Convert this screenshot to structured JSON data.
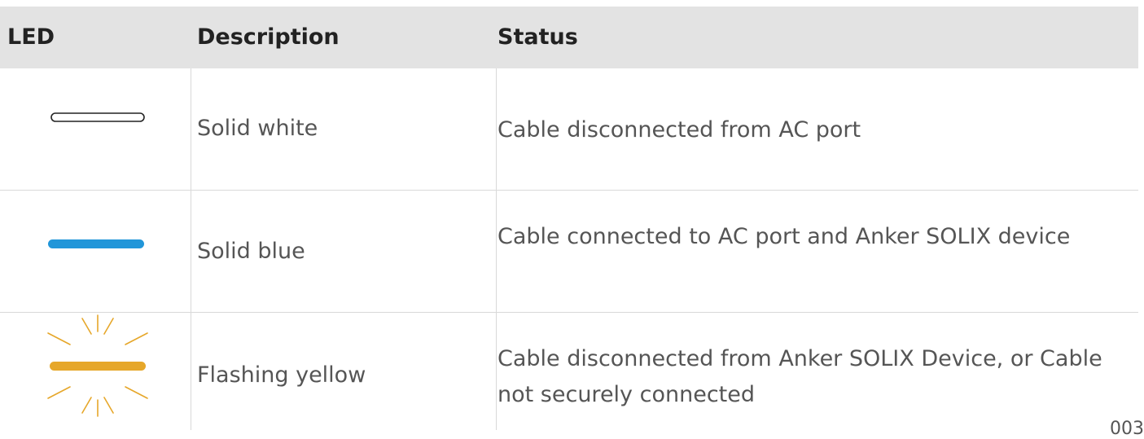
{
  "columns": {
    "led": "LED",
    "description": "Description",
    "status": "Status"
  },
  "rows": [
    {
      "led_icon": "led-solid-white-icon",
      "description": "Solid white",
      "status": "Cable disconnected from AC port"
    },
    {
      "led_icon": "led-solid-blue-icon",
      "description": "Solid blue",
      "status": "Cable connected to AC port and Anker SOLIX device"
    },
    {
      "led_icon": "led-flashing-yellow-icon",
      "description": "Flashing yellow",
      "status": "Cable disconnected from Anker SOLIX Device, or Cable not securely connected"
    }
  ],
  "colors": {
    "header_bg": "#e3e3e3",
    "led_white": "#ffffff",
    "led_blue": "#2196d9",
    "led_yellow": "#e6a72a"
  },
  "page_number": "003"
}
